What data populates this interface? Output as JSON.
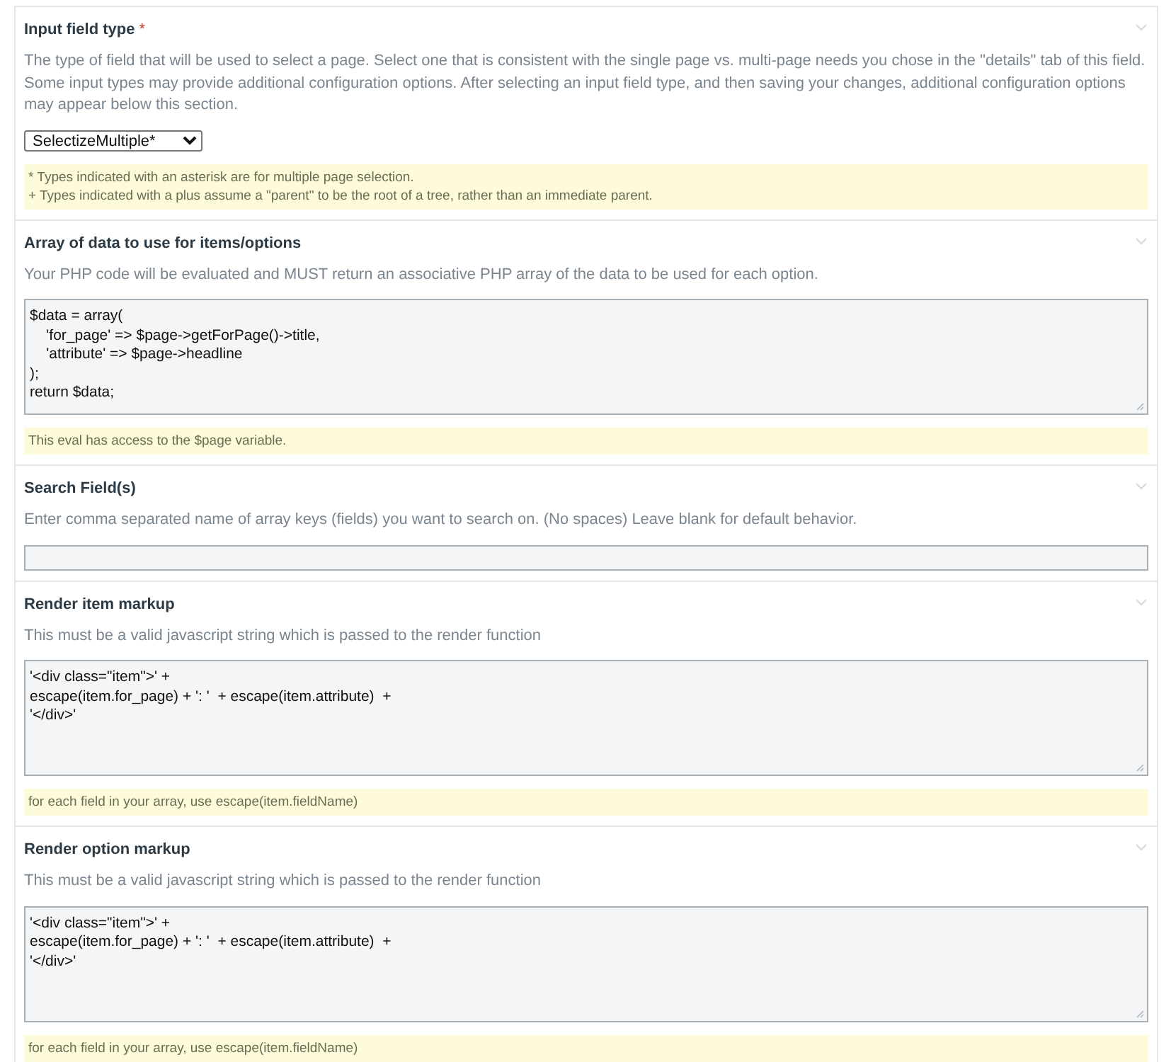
{
  "sections": [
    {
      "kind": "select",
      "title": "Input field type",
      "required_mark": "*",
      "description": "The type of field that will be used to select a page. Select one that is consistent with the single page vs. multi-page needs you chose in the \"details\" tab of this field. Some input types may provide additional configuration options. After selecting an input field type, and then saving your changes, additional configuration options may appear below this section.",
      "value": "SelectizeMultiple*",
      "notes": [
        "* Types indicated with an asterisk are for multiple page selection.",
        "+ Types indicated with a plus assume a \"parent\" to be the root of a tree, rather than an immediate parent."
      ]
    },
    {
      "kind": "textarea",
      "title": "Array of data to use for items/options",
      "description": "Your PHP code will be evaluated and MUST return an associative PHP array of the data to be used for each option.",
      "value": "$data = array(\n    'for_page' => $page->getForPage()->title,\n    'attribute' => $page->headline\n);\nreturn $data;",
      "notes": [
        "This eval has access to the $page variable."
      ]
    },
    {
      "kind": "text",
      "title": "Search Field(s)",
      "description": "Enter comma separated name of array keys (fields) you want to search on. (No spaces) Leave blank for default behavior."
    },
    {
      "kind": "textarea",
      "title": "Render item markup",
      "description": "This must be a valid javascript string which is passed to the render function",
      "value": "'<div class=\"item\">' +\nescape(item.for_page) + ': '  + escape(item.attribute)  +\n'</div>'",
      "notes": [
        "for each field in your array, use escape(item.fieldName)"
      ]
    },
    {
      "kind": "textarea",
      "title": "Render option markup",
      "description": "This must be a valid javascript string which is passed to the render function",
      "value": "'<div class=\"item\">' +\nescape(item.for_page) + ': '  + escape(item.attribute)  +\n'</div>'",
      "notes": [
        "for each field in your array, use escape(item.fieldName)"
      ]
    }
  ]
}
